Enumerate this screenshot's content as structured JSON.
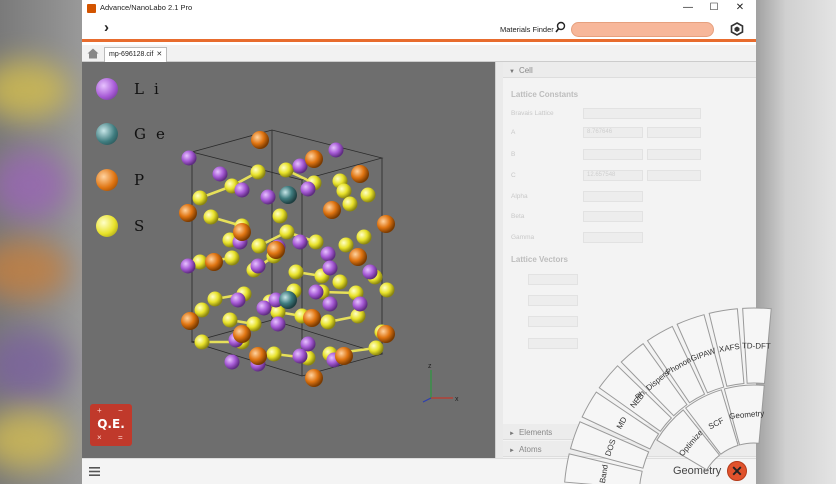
{
  "window": {
    "title": "Advance/NanoLabo 2.1 Pro",
    "minimize": "—",
    "maximize": "☐",
    "close": "✕"
  },
  "toolbar": {
    "expand_glyph": "›",
    "materials_finder_label": "Materials Finder",
    "materials_finder_value": ""
  },
  "tabs": {
    "file_tab": "mp-696128.cif",
    "file_tab_close": "✕"
  },
  "legend": [
    {
      "symbol": "Li",
      "color": "#a75bd6"
    },
    {
      "symbol": "Ge",
      "color": "#3f7c7f"
    },
    {
      "symbol": "P",
      "color": "#e07512"
    },
    {
      "symbol": "S",
      "color": "#e8e22a"
    }
  ],
  "axes": {
    "z": "z",
    "x": "x"
  },
  "qe_logo": {
    "text": "Q.E.",
    "symbols": [
      "+",
      "−",
      "×",
      "="
    ]
  },
  "panel": {
    "cell_header": "Cell",
    "lattice_constants": "Lattice Constants",
    "bravais_lattice": "Bravais Lattice",
    "a_label": "A",
    "a_value": "8.767646",
    "b_label": "B",
    "c_label": "C",
    "c_value": "12.657548",
    "alpha_label": "Alpha",
    "beta_label": "Beta",
    "gamma_label": "Gamma",
    "lattice_vectors": "Lattice Vectors",
    "elements_header": "Elements",
    "atoms_header": "Atoms"
  },
  "radial_menu": {
    "outer": [
      "Band",
      "DOS",
      "MD",
      "NEB",
      "Ph. Dispersion",
      "Phonon",
      "GIPAW",
      "XAFS",
      "TD-DFT"
    ],
    "inner": [
      "Optimize",
      "SCF",
      "Geometry"
    ]
  },
  "bottombar": {
    "mode_label": "Geometry",
    "close_glyph": "✕"
  },
  "colors": {
    "accent": "#e86c2e",
    "search_fill": "#f7b79a",
    "close_button": "#e0522c",
    "viewport_bg": "#6e6e6e"
  }
}
